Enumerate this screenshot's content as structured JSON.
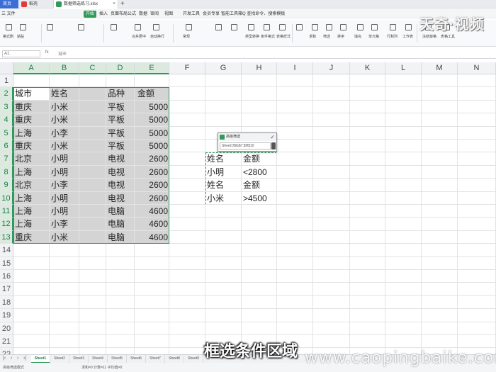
{
  "tabs": {
    "home": "首页",
    "docer": "稻壳",
    "file": "数据筛选练习.xlsx"
  },
  "menu": [
    "三 文件",
    "",
    "",
    "开始",
    "插入",
    "页面布局",
    "公式",
    "数据",
    "审阅",
    "视图",
    "开发工具",
    "会员专享",
    "智能工具箱",
    "Q 查找命令、搜索模板"
  ],
  "toolbar": [
    "格式刷",
    "粘贴",
    "",
    "",
    "",
    "合并居中",
    "自动换行",
    "常规",
    "",
    "",
    "类型转换",
    "条件格式",
    "表格样式",
    "",
    "求和",
    "筛选",
    "排序",
    "填充",
    "单元格",
    "行和列",
    "工作表",
    "冻结窗格",
    "表格工具"
  ],
  "namebox": "A1",
  "fx": "fx",
  "formula": "城市",
  "columns": [
    "A",
    "B",
    "C",
    "D",
    "E",
    "F",
    "G",
    "H",
    "I",
    "J",
    "K",
    "L",
    "M",
    "N"
  ],
  "rows": [
    "1",
    "2",
    "3",
    "4",
    "5",
    "6",
    "7",
    "8",
    "9",
    "10",
    "11",
    "12",
    "13",
    "14",
    "15",
    "16",
    "17",
    "18",
    "19",
    "20",
    "21",
    "22"
  ],
  "table": {
    "headers": {
      "city": "城市",
      "name": "姓名",
      "product": "品种",
      "amount": "金额"
    },
    "records": [
      [
        "重庆",
        "小米",
        "平板",
        "5000"
      ],
      [
        "重庆",
        "小米",
        "平板",
        "5000"
      ],
      [
        "上海",
        "小李",
        "平板",
        "5000"
      ],
      [
        "重庆",
        "小米",
        "平板",
        "5000"
      ],
      [
        "北京",
        "小明",
        "电视",
        "2600"
      ],
      [
        "上海",
        "小明",
        "电视",
        "2600"
      ],
      [
        "北京",
        "小李",
        "电视",
        "2600"
      ],
      [
        "上海",
        "小明",
        "电视",
        "2600"
      ],
      [
        "上海",
        "小明",
        "电脑",
        "4600"
      ],
      [
        "上海",
        "小李",
        "电脑",
        "4600"
      ],
      [
        "重庆",
        "小米",
        "电脑",
        "4600"
      ]
    ]
  },
  "criteria": [
    [
      "姓名",
      "金额"
    ],
    [
      "小明",
      "<2800"
    ],
    [
      "姓名",
      "金额"
    ],
    [
      "小米",
      ">4500"
    ]
  ],
  "dialog": {
    "title": "高级筛选",
    "value": "Sheet1!$G$7:$H$10"
  },
  "sheets": [
    "Sheet1",
    "Sheet2",
    "Sheet3",
    "Sheet4",
    "Sheet5",
    "Sheet6",
    "Sheet7",
    "Sheet8",
    "Sheet9"
  ],
  "status": {
    "left": "高级筛选模式",
    "mid": "求和=0 计数=11 平均值=0"
  },
  "watermark": "天奇·视频",
  "caption": "框选条件区域",
  "site": "www.caopingbaike.com",
  "colors": {
    "accent": "#2e9b5a",
    "selection": "#d4d4d4",
    "tab_blue": "#3a6fd8"
  }
}
